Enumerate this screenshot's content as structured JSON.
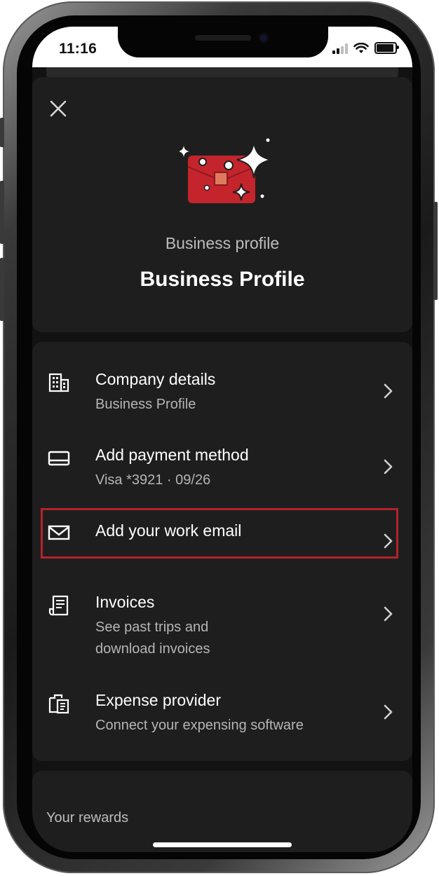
{
  "status_bar": {
    "time": "11:16"
  },
  "header": {
    "close_icon": "close-icon",
    "hero_icon": "briefcase-sparkle-icon",
    "subtitle": "Business profile",
    "title": "Business Profile"
  },
  "menu": {
    "items": [
      {
        "icon": "building-icon",
        "title": "Company details",
        "subtitle": "Business Profile"
      },
      {
        "icon": "card-icon",
        "title": "Add payment method",
        "subtitle": "Visa *3921 · 09/26"
      },
      {
        "icon": "envelope-icon",
        "title": "Add your work email",
        "subtitle": ""
      },
      {
        "icon": "receipt-icon",
        "title": "Invoices",
        "subtitle_line1": "See past trips and",
        "subtitle_line2": "download invoices"
      },
      {
        "icon": "expense-icon",
        "title": "Expense provider",
        "subtitle": "Connect your expensing software"
      }
    ]
  },
  "rewards": {
    "label": "Your rewards"
  },
  "colors": {
    "background": "#121212",
    "card": "#1f1e1e",
    "accent_red": "#b3232b",
    "icon_red": "#c4242c"
  }
}
